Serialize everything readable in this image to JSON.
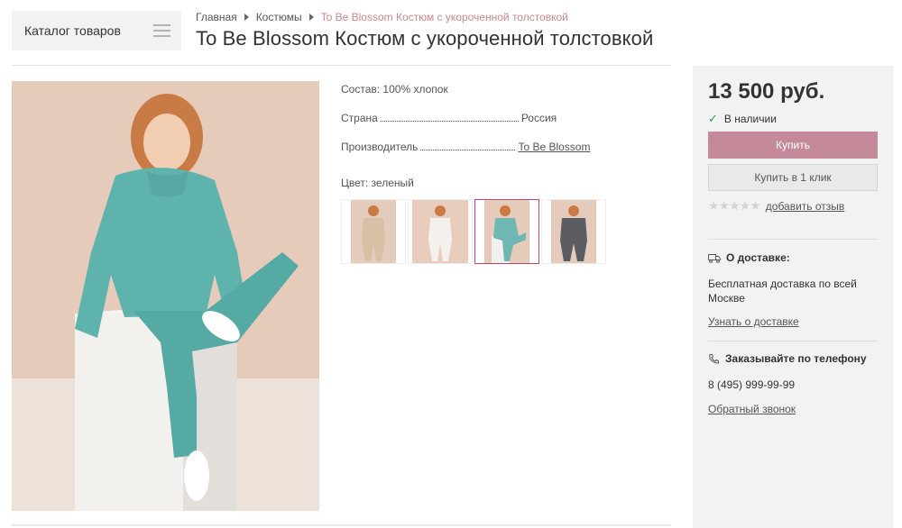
{
  "catalog": {
    "label": "Каталог товаров"
  },
  "breadcrumb": {
    "items": [
      "Главная",
      "Костюмы"
    ],
    "current": "To Be Blossom Костюм с укороченной толстовкой"
  },
  "product": {
    "title": "To Be Blossom Костюм с укороченной толстовкой",
    "composition": "Состав: 100% хлопок",
    "country_label": "Страна",
    "country_value": "Россия",
    "maker_label": "Производитель",
    "maker_value": "To Be Blossom",
    "color_label": "Цвет: зеленый",
    "thumbnails": [
      {
        "name": "beige",
        "color": "#d7c0a6"
      },
      {
        "name": "white",
        "color": "#f2efea"
      },
      {
        "name": "green",
        "color": "#6fb7b3",
        "active": true
      },
      {
        "name": "grey",
        "color": "#5b5d63"
      }
    ]
  },
  "sidebar": {
    "price": "13 500 руб.",
    "stock": "В наличии",
    "buy_label": "Купить",
    "oneclick_label": "Купить в 1 клик",
    "review_link": "добавить отзыв",
    "rating_stars": 0,
    "delivery_title": "О доставке:",
    "delivery_text": "Бесплатная доставка по всей Москве",
    "delivery_link": "Узнать о доставке",
    "phone_title": "Заказывайте по телефону",
    "phone": "8 (495) 999-99-99",
    "callback_link": "Обратный звонок"
  },
  "colors": {
    "accent": "#c48a99",
    "active_border": "#c4456f",
    "breadcrumb_current": "#c88a8a",
    "stock_check": "#2e9a44"
  }
}
